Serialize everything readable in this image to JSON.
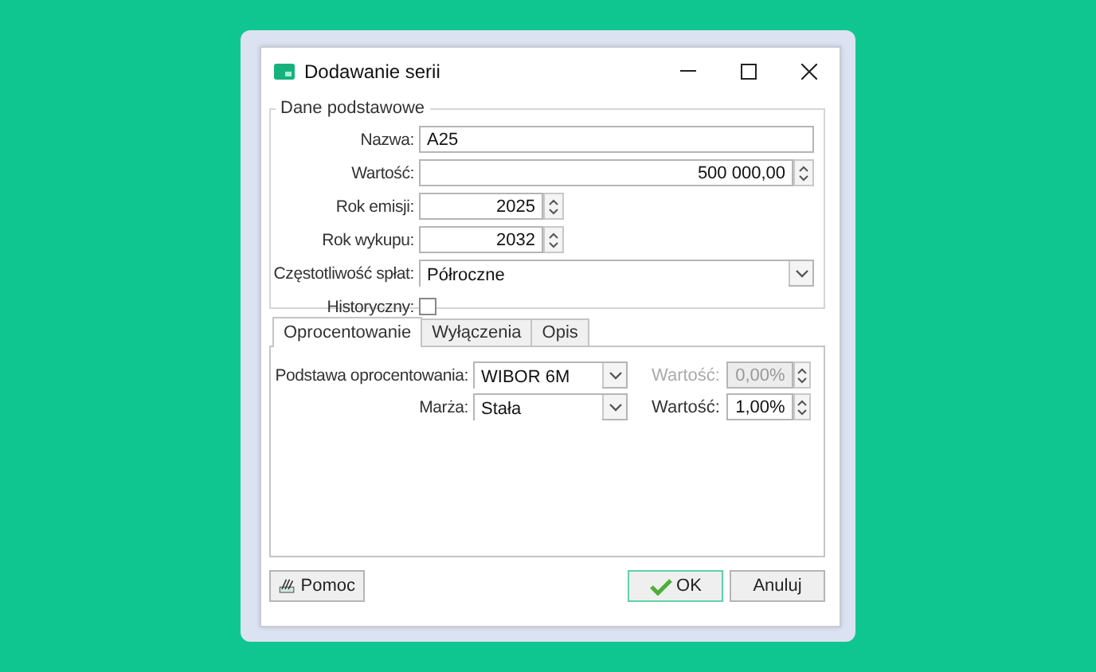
{
  "window": {
    "title": "Dodawanie serii"
  },
  "basic": {
    "legend": "Dane podstawowe",
    "fields": [
      {
        "kind": "text",
        "label": "Nazwa:",
        "value": "A25"
      },
      {
        "kind": "amount",
        "label": "Wartość:",
        "value": "500 000,00"
      },
      {
        "kind": "year",
        "label": "Rok emisji:",
        "value": "2025"
      },
      {
        "kind": "year",
        "label": "Rok wykupu:",
        "value": "2032"
      },
      {
        "kind": "select",
        "label": "Częstotliwość spłat:",
        "value": "Półroczne"
      },
      {
        "kind": "checkbox",
        "label": "Historyczny:",
        "checked": false
      }
    ]
  },
  "tabs": [
    {
      "label": "Oprocentowanie",
      "selected": true
    },
    {
      "label": "Wyłączenia",
      "selected": false
    },
    {
      "label": "Opis",
      "selected": false
    }
  ],
  "rate_rows": [
    {
      "label": "Podstawa oprocentowania:",
      "select": "WIBOR 6M",
      "value_label": "Wartość:",
      "value": "0,00%",
      "disabled": true
    },
    {
      "label": "Marża:",
      "select": "Stała",
      "value_label": "Wartość:",
      "value": "1,00%",
      "disabled": false
    }
  ],
  "buttons": [
    {
      "kind": "help",
      "label": "Pomoc"
    },
    {
      "kind": "ok",
      "label": "OK",
      "focused": true
    },
    {
      "kind": "cancel",
      "label": "Anuluj",
      "focused": false
    }
  ]
}
